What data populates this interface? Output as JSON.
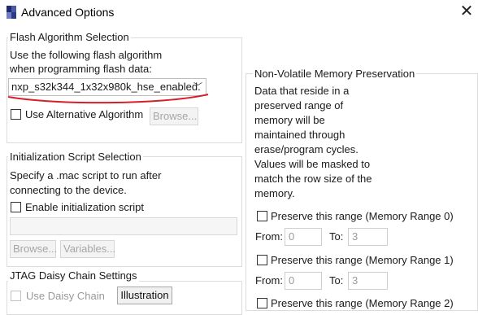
{
  "window": {
    "title": "Advanced Options"
  },
  "flash": {
    "group_label": "Flash Algorithm Selection",
    "description_line1": "Use the following flash algorithm",
    "description_line2": "when programming flash data:",
    "algorithm_value": "nxp_s32k344_1x32x980k_hse_enabled.",
    "alt_checkbox_label": "Use Alternative Algorithm",
    "browse_label": "Browse..."
  },
  "init_script": {
    "group_label": "Initialization Script Selection",
    "description_line1": "Specify a .mac script to run after",
    "description_line2": "connecting to the device.",
    "enable_label": "Enable initialization script",
    "path_value": "",
    "browse_label": "Browse...",
    "variables_label": "Variables..."
  },
  "jtag": {
    "group_label": "JTAG Daisy Chain Settings",
    "use_daisy_label": "Use Daisy Chain",
    "illustration_label": "Illustration"
  },
  "nvm": {
    "group_label": "Non-Volatile Memory Preservation",
    "description_lines": [
      "Data that reside in a",
      "preserved range of",
      "memory will be",
      "maintained through",
      "erase/program cycles.",
      "Values will be masked to",
      "match the row size of the",
      "memory."
    ],
    "range0_label": "Preserve this range (Memory Range 0)",
    "range0_from_label": "From:",
    "range0_from_value": "0",
    "range0_to_label": "To:",
    "range0_to_value": "3",
    "range1_label": "Preserve this range (Memory Range 1)",
    "range1_from_label": "From:",
    "range1_from_value": "0",
    "range1_to_label": "To:",
    "range1_to_value": "3",
    "range2_label": "Preserve this range (Memory Range 2)"
  },
  "colors": {
    "annotation_underline": "#d61f2b"
  },
  "icons": {
    "close": "close-icon",
    "dropdown": "chevron-down-icon",
    "app": "app-icon"
  }
}
